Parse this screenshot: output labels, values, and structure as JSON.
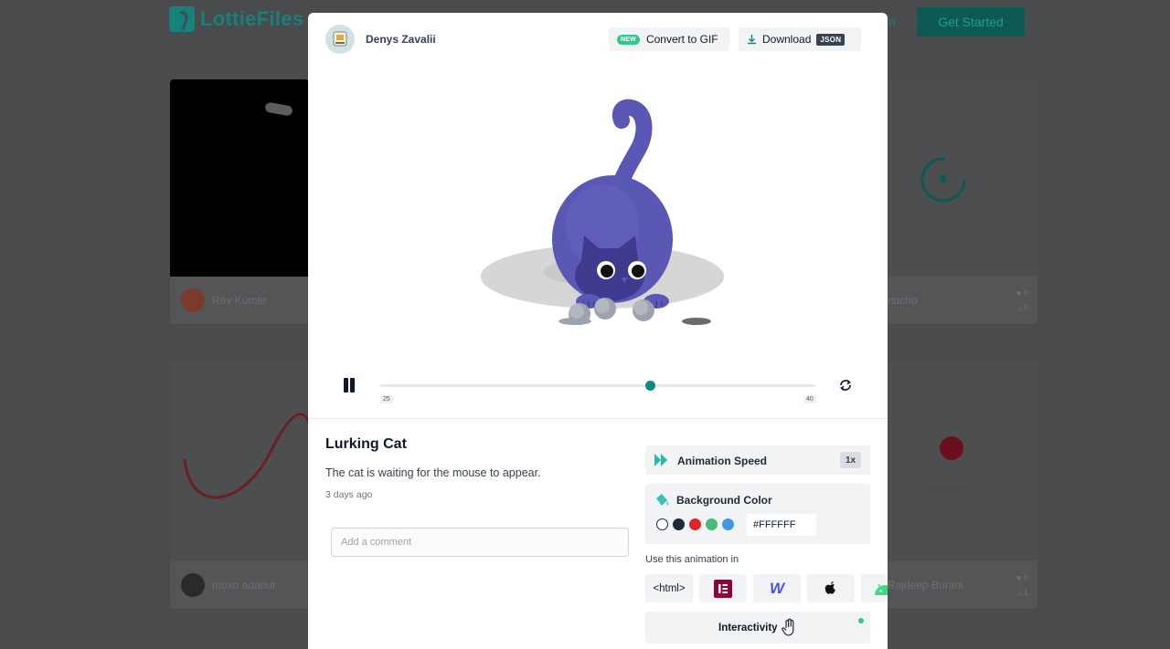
{
  "background": {
    "logo_text": "LottieFiles",
    "nav_partial": "n",
    "cta_label": "Get Started",
    "cards": [
      {
        "author": "Rav Kumar",
        "likes": "",
        "downloads": ""
      },
      {
        "author": "nacho",
        "likes": "0",
        "downloads": "0"
      },
      {
        "author": "muxo adanur",
        "likes": "",
        "downloads": ""
      },
      {
        "author": "Rajdeep Burani",
        "likes": "0",
        "downloads": "1"
      }
    ]
  },
  "modal": {
    "author": "Denys Zavalii",
    "convert_badge": "NEW",
    "convert_label": "Convert to GIF",
    "download_label": "Download",
    "download_badge": "JSON",
    "player": {
      "frame_start": "25",
      "frame_end": "40",
      "progress": 0.62
    },
    "animation": {
      "title": "Lurking Cat",
      "description": "The cat is waiting for the mouse to appear.",
      "posted": "3 days ago"
    },
    "comment_placeholder": "Add a comment",
    "speed": {
      "label": "Animation Speed",
      "value": "1x"
    },
    "background_color": {
      "label": "Background Color",
      "swatches": [
        "#FFFFFF",
        "#1F2937",
        "#DC2626",
        "#48BB78",
        "#4299E1"
      ],
      "hex": "#FFFFFF"
    },
    "use_in_label": "Use this animation in",
    "platforms": [
      {
        "name": "html",
        "label": "<html>"
      },
      {
        "name": "elementor",
        "label": ""
      },
      {
        "name": "webflow",
        "label": "W"
      },
      {
        "name": "apple",
        "label": ""
      },
      {
        "name": "android",
        "label": ""
      }
    ],
    "interactivity_label": "Interactivity",
    "colors": {
      "accent": "#0F8A80",
      "new_badge": "#2FC98A",
      "cat": "#5A57B5"
    }
  }
}
